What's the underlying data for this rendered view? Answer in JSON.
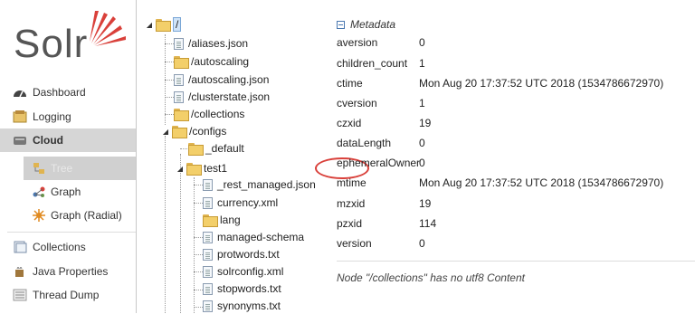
{
  "logo": {
    "text": "Solr"
  },
  "nav": {
    "dashboard": "Dashboard",
    "logging": "Logging",
    "cloud": "Cloud",
    "cloud_sub": {
      "tree": "Tree",
      "graph": "Graph",
      "graph_radial": "Graph (Radial)"
    },
    "collections": "Collections",
    "java_properties": "Java Properties",
    "thread_dump": "Thread Dump"
  },
  "tree": {
    "root": "/",
    "items": [
      "/aliases.json",
      "/autoscaling",
      "/autoscaling.json",
      "/clusterstate.json",
      "/collections",
      "/configs",
      "_default",
      "test1",
      "_rest_managed.json",
      "currency.xml",
      "lang",
      "managed-schema",
      "protwords.txt",
      "solrconfig.xml",
      "stopwords.txt",
      "synonyms.txt"
    ]
  },
  "metadata": {
    "heading": "Metadata",
    "rows": [
      {
        "key": "aversion",
        "value": "0"
      },
      {
        "key": "children_count",
        "value": "1"
      },
      {
        "key": "ctime",
        "value": "Mon Aug 20 17:37:52 UTC 2018 (1534786672970)"
      },
      {
        "key": "cversion",
        "value": "1"
      },
      {
        "key": "czxid",
        "value": "19"
      },
      {
        "key": "dataLength",
        "value": "0"
      },
      {
        "key": "ephemeralOwner",
        "value": "0"
      },
      {
        "key": "mtime",
        "value": "Mon Aug 20 17:37:52 UTC 2018 (1534786672970)"
      },
      {
        "key": "mzxid",
        "value": "19"
      },
      {
        "key": "pzxid",
        "value": "114"
      },
      {
        "key": "version",
        "value": "0"
      }
    ],
    "note": "Node \"/collections\" has no utf8 Content"
  },
  "colors": {
    "accent": "#d9403a",
    "active_bg": "#d6d6d6",
    "folder": "#f3cf6a"
  }
}
